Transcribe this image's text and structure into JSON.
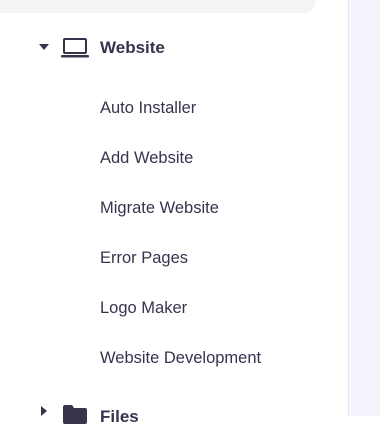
{
  "sidebar": {
    "website_section": {
      "title": "Website",
      "icon": "laptop-icon",
      "expanded": true,
      "items": [
        {
          "label": "Auto Installer"
        },
        {
          "label": "Add Website"
        },
        {
          "label": "Migrate Website"
        },
        {
          "label": "Error Pages"
        },
        {
          "label": "Logo Maker"
        },
        {
          "label": "Website Development"
        }
      ]
    },
    "files_section": {
      "title": "Files",
      "icon": "folder-icon",
      "expanded": false
    }
  },
  "colors": {
    "text": "#36344d",
    "main_background": "#f4f4fd",
    "active_item_background": "#f4f4f6"
  }
}
